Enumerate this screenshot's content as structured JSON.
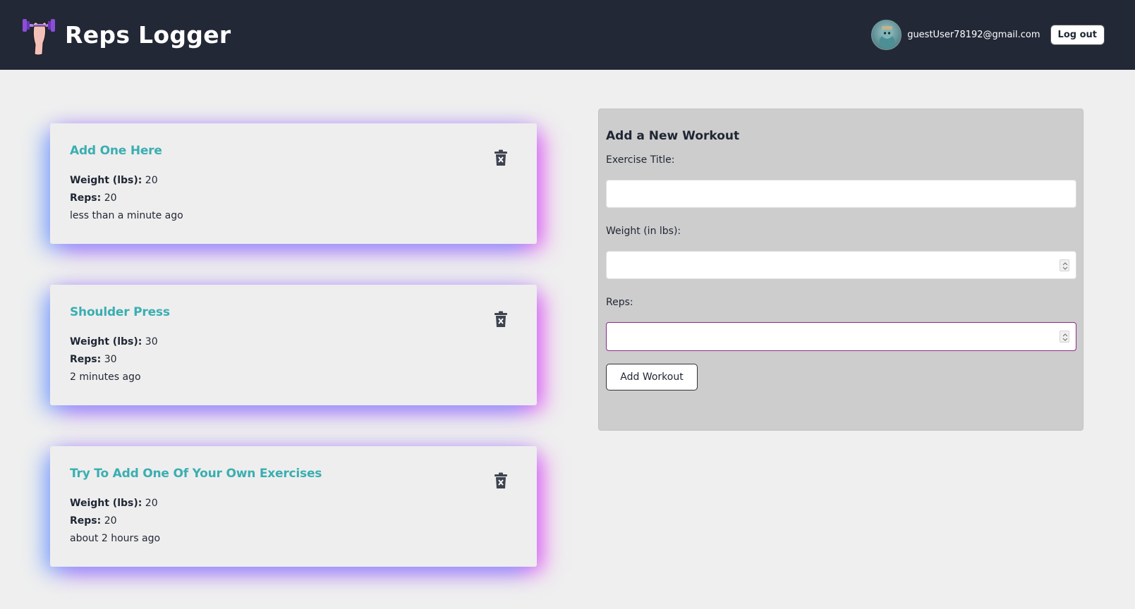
{
  "header": {
    "brand_title": "Reps Logger",
    "user_email": "guestUser78192@gmail.com",
    "logout_label": "Log out"
  },
  "workouts": [
    {
      "title": "Add One Here",
      "weight_label": "Weight (lbs):",
      "weight": "20",
      "reps_label": "Reps:",
      "reps": "20",
      "time": "less than a minute ago"
    },
    {
      "title": "Shoulder Press",
      "weight_label": "Weight (lbs):",
      "weight": "30",
      "reps_label": "Reps:",
      "reps": "30",
      "time": "2 minutes ago"
    },
    {
      "title": "Try To Add One Of Your Own Exercises",
      "weight_label": "Weight (lbs):",
      "weight": "20",
      "reps_label": "Reps:",
      "reps": "20",
      "time": "about 2 hours ago"
    }
  ],
  "form": {
    "heading": "Add a New Workout",
    "title_label": "Exercise Title:",
    "title_value": "",
    "weight_label": "Weight (in lbs):",
    "weight_value": "",
    "reps_label": "Reps:",
    "reps_value": "",
    "submit_label": "Add Workout"
  },
  "colors": {
    "navbar": "#232837",
    "accent_title": "#3aaeb1",
    "background": "#efefef",
    "form_panel": "#cdcdcd",
    "focus_border": "#8a2b8a"
  },
  "icons": {
    "logo": "dumbbell-arm-logo",
    "delete": "trash-icon"
  }
}
